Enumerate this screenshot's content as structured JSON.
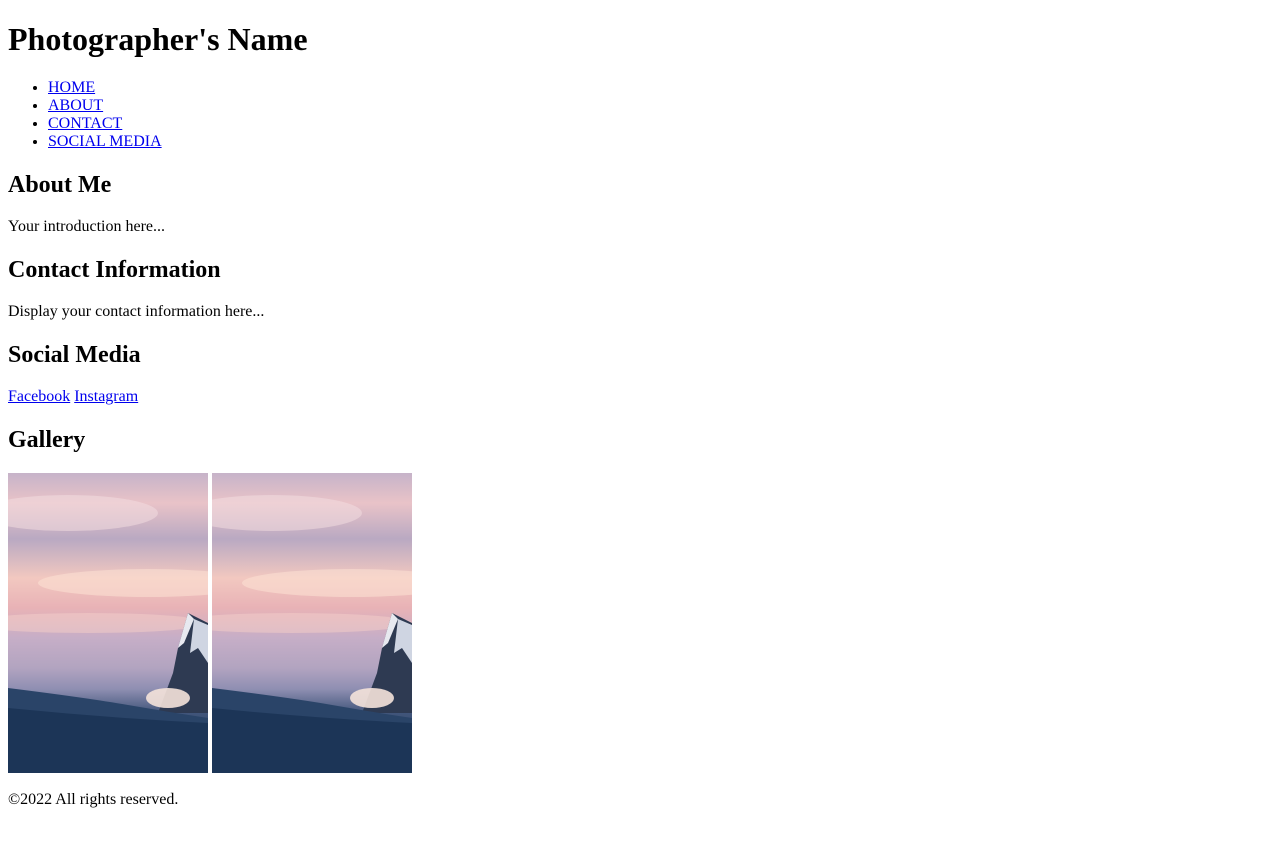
{
  "header": {
    "title": "Photographer's Name"
  },
  "nav": {
    "items": [
      {
        "label": "HOME"
      },
      {
        "label": "ABOUT"
      },
      {
        "label": "CONTACT"
      },
      {
        "label": "SOCIAL MEDIA"
      }
    ]
  },
  "about": {
    "heading": "About Me",
    "text": "Your introduction here..."
  },
  "contact": {
    "heading": "Contact Information",
    "text": "Display your contact information here..."
  },
  "social": {
    "heading": "Social Media",
    "links": [
      {
        "label": "Facebook"
      },
      {
        "label": "Instagram"
      }
    ]
  },
  "gallery": {
    "heading": "Gallery",
    "images": [
      {
        "subject": "snowy-mountain-peak-at-sunset"
      },
      {
        "subject": "snowy-mountain-peak-at-sunset"
      }
    ]
  },
  "footer": {
    "text": "©2022 All rights reserved."
  },
  "colors": {
    "link": "#0000ee",
    "text": "#000000",
    "background": "#ffffff"
  }
}
